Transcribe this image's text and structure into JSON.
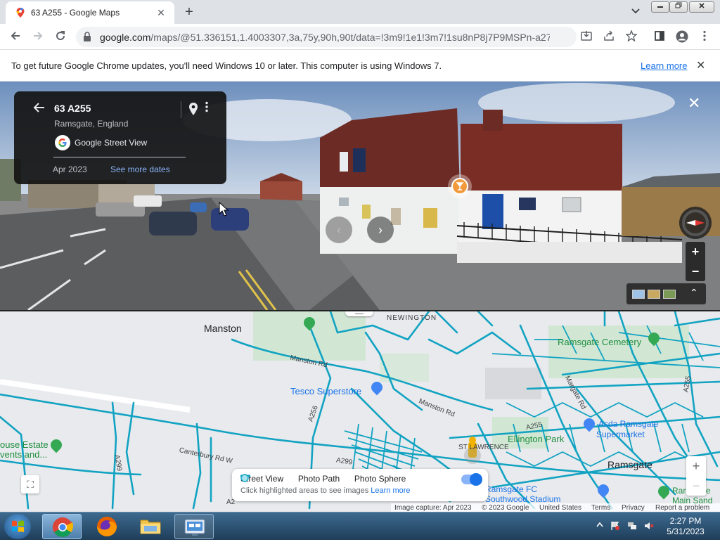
{
  "browser": {
    "tab_title": "63 A255 - Google Maps",
    "tab_close": "✕",
    "new_tab": "+",
    "url_host": "google.com",
    "url_path": "/maps/@51.336151,1.4003307,3a,75y,90h,90t/data=!3m9!1e1!3m7!1su8nP8j7P9MSPn-a277ym..."
  },
  "infobar": {
    "message": "To get future Google Chrome updates, you'll need Windows 10 or later. This computer is using Windows 7.",
    "learn_more": "Learn more",
    "close": "✕"
  },
  "street_view_card": {
    "address": "63 A255",
    "locality": "Ramsgate, England",
    "source": "Google Street View",
    "date": "Apr 2023",
    "see_more_dates": "See more dates"
  },
  "street_view": {
    "close": "✕",
    "prev": "‹",
    "next": "›",
    "zoom_in": "+",
    "zoom_out": "−",
    "expand": "⌃"
  },
  "map": {
    "places": {
      "manston": "Manston",
      "newington": "NEWINGTON",
      "ramsgate_cemetery": "Ramsgate Cemetery",
      "tesco": "Tesco Superstore",
      "asda_line1": "Asda Ramsgate",
      "asda_line2": "Supermarket",
      "ellington_park": "Ellington Park",
      "st_lawrence": "ST LAWRENCE",
      "ramsgate": "Ramsgate",
      "house_estate_1": "ouse Estate",
      "house_estate_2": "vents and...",
      "ramsgate_fc": "Ramsgate FC",
      "southwood": "Southwood Stadium",
      "ramsgate_main_1": "Ramsgate",
      "ramsgate_main_2": "Main Sand"
    },
    "roads": {
      "manston_rd_1": "Manston Rd",
      "manston_rd_2": "Manston Rd",
      "canterbury_rd_w": "Canterbury Rd W",
      "a256": "A256",
      "a299": "A299",
      "a299_b": "A299",
      "a255": "A255",
      "a255_b": "A255",
      "margate_rd": "Margate Rd",
      "a2": "A2"
    },
    "legend": {
      "street_view": "Street View",
      "photo_path": "Photo Path",
      "photo_sphere": "Photo Sphere",
      "hint": "Click highlighted areas to see images",
      "learn_more": "Learn more",
      "toggle_on": true
    },
    "zoom_in": "+",
    "zoom_out": "−",
    "expand": "⛶",
    "attribution": {
      "capture": "Image capture: Apr 2023",
      "copyright": "© 2023 Google",
      "country": "United States",
      "terms": "Terms",
      "privacy": "Privacy",
      "report": "Report a problem"
    }
  },
  "taskbar": {
    "time": "2:27 PM",
    "date": "5/31/2023"
  },
  "colors": {
    "street_view_line": "#0ea5c6",
    "map_background": "#e8eaed",
    "park_green": "#c8e6c9",
    "link_blue": "#1a73e8"
  }
}
